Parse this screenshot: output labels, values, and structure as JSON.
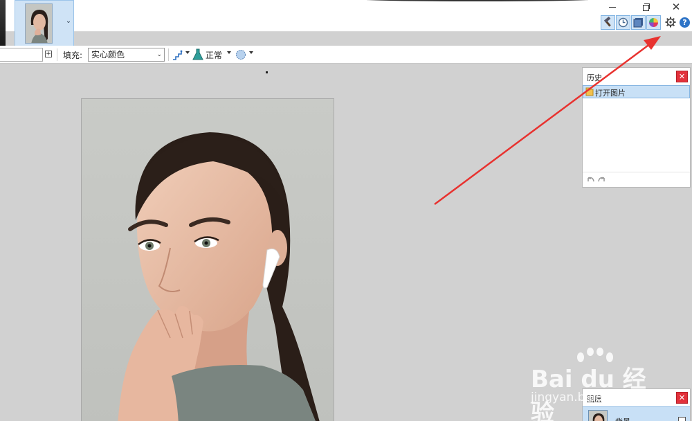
{
  "toolbar": {
    "fill_label": "填充:",
    "fill_value": "实心颜色",
    "blend_mode": "正常"
  },
  "history_panel": {
    "title": "历史",
    "items": [
      {
        "label": "打开图片"
      }
    ]
  },
  "layers_panel": {
    "title": "图层",
    "items": [
      {
        "label": "背景"
      }
    ]
  },
  "watermark": {
    "main": "Bai du 经验",
    "sub": "jingyan.baidu.com"
  },
  "colors": {
    "accent_selection": "#c8e0f6",
    "close_red": "#e2313b",
    "annotation_arrow": "#e8322f",
    "canvas_bg": "#d1d1d1"
  },
  "icons": {
    "panel_toggles": [
      "tools-hammer-icon",
      "history-clock-icon",
      "layers-icon",
      "colors-wheel-icon"
    ]
  }
}
